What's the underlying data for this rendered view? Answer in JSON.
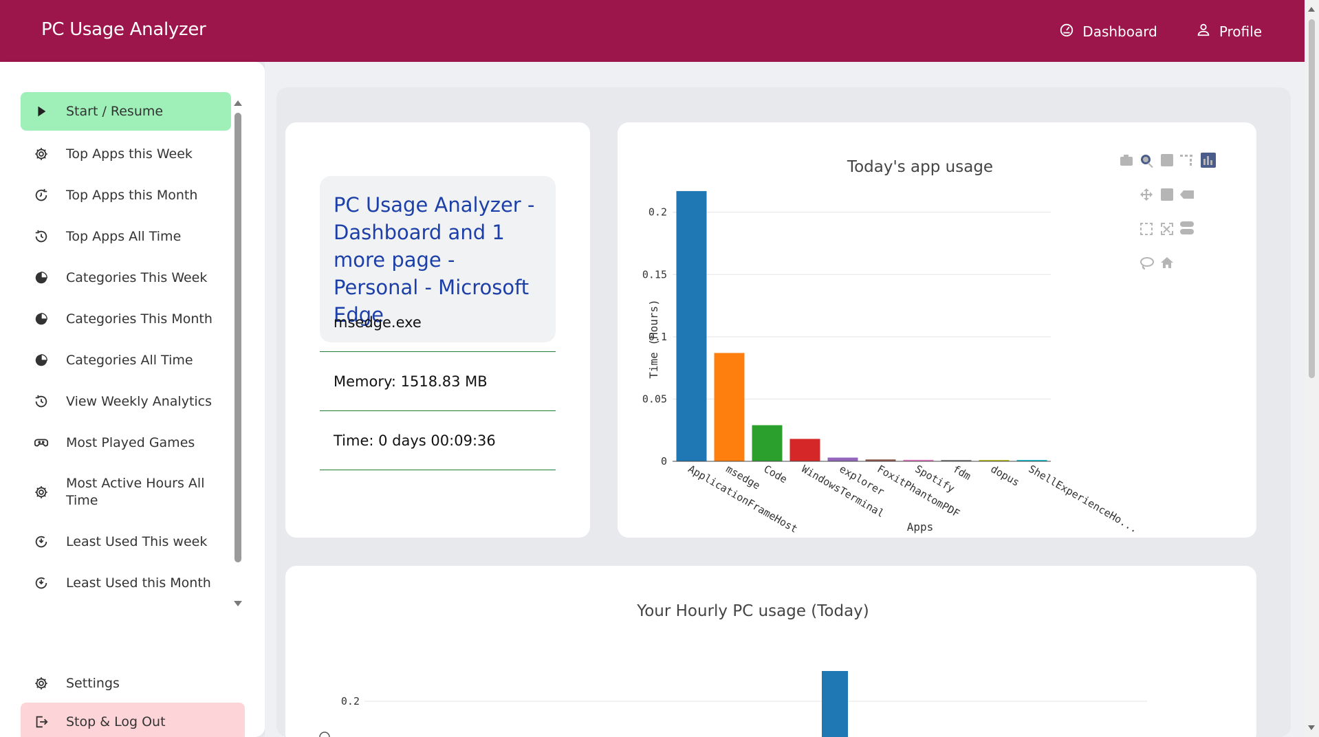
{
  "header": {
    "brand": "PC Usage Analyzer",
    "nav": [
      {
        "label": "Dashboard",
        "icon": "dashboard-gauge-icon"
      },
      {
        "label": "Profile",
        "icon": "user-icon"
      }
    ]
  },
  "colors": {
    "header_bg": "#9c164c",
    "start_bg": "#9ef0b8",
    "logout_bg": "#fdd5d8",
    "title_blue": "#1c3fa8"
  },
  "sidebar": {
    "items": [
      {
        "label": "Start / Resume",
        "icon": "play-icon"
      },
      {
        "label": "Top Apps this Week",
        "icon": "gear-icon"
      },
      {
        "label": "Top Apps this Month",
        "icon": "clock-arrow-icon"
      },
      {
        "label": "Top Apps All Time",
        "icon": "history-icon"
      },
      {
        "label": "Categories This Week",
        "icon": "pie-chart-icon"
      },
      {
        "label": "Categories This Month",
        "icon": "pie-chart-icon"
      },
      {
        "label": "Categories All Time",
        "icon": "pie-chart-icon"
      },
      {
        "label": "View Weekly Analytics",
        "icon": "history-icon"
      },
      {
        "label": "Most Played Games",
        "icon": "gamepad-icon"
      },
      {
        "label": "Most Active Hours All Time",
        "icon": "gear-icon"
      },
      {
        "label": "Least Used This week",
        "icon": "clock-down-icon"
      },
      {
        "label": "Least Used this Month",
        "icon": "clock-down-icon"
      }
    ],
    "bottom": [
      {
        "label": "Settings",
        "icon": "gear-icon"
      },
      {
        "label": "Stop & Log Out",
        "icon": "logout-icon"
      }
    ]
  },
  "current_window": {
    "title": "PC Usage Analyzer - Dashboard and 1 more page - Personal - Microsoft Edge",
    "process": "msedge.exe",
    "memory": "Memory: 1518.83 MB",
    "time": "Time: 0 days 00:09:36"
  },
  "chart_data": [
    {
      "type": "bar",
      "title": "Today's app usage",
      "xlabel": "Apps",
      "ylabel": "Time (Hours)",
      "categories": [
        "ApplicationFrameHost",
        "msedge",
        "Code",
        "WindowsTerminal",
        "explorer",
        "FoxitPhantomPDF",
        "Spotify",
        "fdm",
        "dopus",
        "ShellExperienceHo..."
      ],
      "values": [
        0.217,
        0.087,
        0.029,
        0.018,
        0.003,
        0.0015,
        0.0012,
        0.001,
        0.0008,
        0.0005
      ],
      "colors": [
        "#1f77b4",
        "#ff7f0e",
        "#2ca02c",
        "#d62728",
        "#9467bd",
        "#8c564b",
        "#e377c2",
        "#7f7f7f",
        "#bcbd22",
        "#17becf"
      ],
      "yticks": [
        "0",
        "0.05",
        "0.1",
        "0.15",
        "0.2"
      ],
      "ylim": [
        0,
        0.228
      ],
      "grid": true
    },
    {
      "type": "bar",
      "title": "Your Hourly PC usage (Today)",
      "yticks": [
        "0.2"
      ],
      "grid": true
    }
  ]
}
